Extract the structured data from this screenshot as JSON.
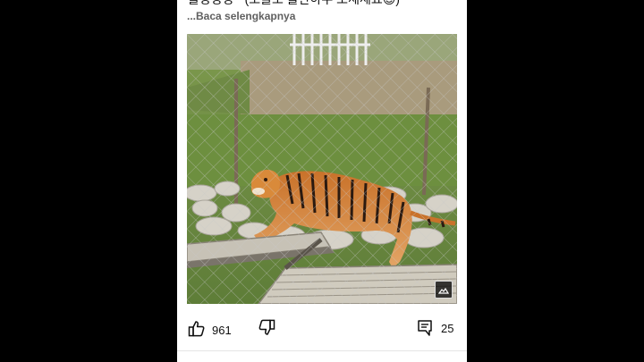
{
  "post": {
    "title": "불쌍쌍쌍~ (보올오 볼만하우 보세세요😊)",
    "read_more": "...Baca selengkapnya",
    "image_alt": "Tiger walking on a wooden ramp behind a chain-link fence"
  },
  "actions": {
    "like_count": "961",
    "comment_count": "25"
  },
  "colors": {
    "page_background": "#000000",
    "card_background": "#ffffff",
    "icon": "#0f0f0f",
    "secondary_text": "#606060"
  },
  "icons": {
    "like": "thumbs-up-icon",
    "dislike": "thumbs-down-icon",
    "comment": "comment-icon",
    "image_badge": "image-icon"
  }
}
